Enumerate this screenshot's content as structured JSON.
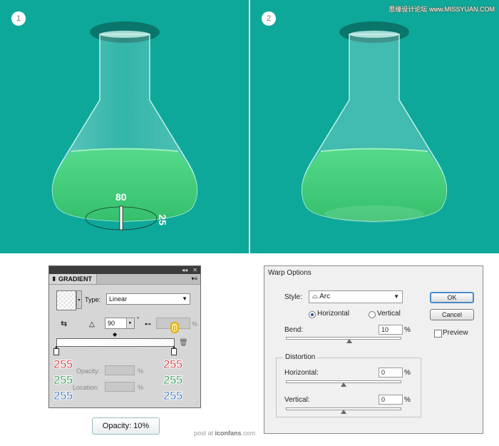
{
  "panel1": {
    "step": "1",
    "label_top": "80",
    "label_side": "25"
  },
  "panel2": {
    "step": "2"
  },
  "watermark": {
    "top": "思缘设计论坛",
    "top_site": "www.MISSYUAN.COM"
  },
  "gradient_panel": {
    "collapse": "◂◂",
    "close": "✕",
    "title": "GRADIENT",
    "menu": "▾≡",
    "type_label": "Type:",
    "type_value": "Linear",
    "angle": "90",
    "degree": "°",
    "aspect_pct": "%",
    "highlight_value": "0",
    "rgb_left": [
      "255",
      "255",
      "255"
    ],
    "rgb_right": [
      "255",
      "255",
      "255"
    ],
    "opacity_label": "Opacity:",
    "location_label": "Location:",
    "pct": "%"
  },
  "tooltip": "Opacity: 10%",
  "credit": {
    "prefix": "post at",
    "site": "iconfans",
    "suffix": ".com"
  },
  "warp": {
    "title": "Warp Options",
    "style_label": "Style:",
    "style_value": "Arc",
    "horizontal": "Horizontal",
    "vertical": "Vertical",
    "bend_label": "Bend:",
    "bend_value": "10",
    "pct": "%",
    "distortion": "Distortion",
    "dist_h_label": "Horizontal:",
    "dist_h_value": "0",
    "dist_v_label": "Vertical:",
    "dist_v_value": "0",
    "ok": "OK",
    "cancel": "Cancel",
    "preview": "Preview",
    "bend_level": 0.55,
    "dist_h_level": 0.5,
    "dist_v_level": 0.5
  },
  "colors": {
    "teal": "#0ea89a",
    "liquid": "#4fd17f",
    "red": "#d8303a",
    "green": "#2c9a4a",
    "blue": "#3a72c0"
  }
}
